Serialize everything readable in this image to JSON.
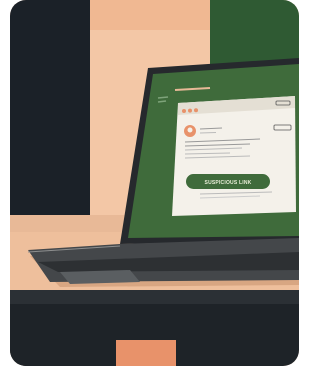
{
  "illustration": {
    "popup": {
      "button_label": "SUSPICIOUS LINK"
    }
  },
  "colors": {
    "dark_navy": "#1b2128",
    "peach": "#f3c7a6",
    "green": "#3f6b3b",
    "dark_green": "#2f5a33",
    "desk": "#e8b997",
    "laptop_body": "#26292d",
    "keyboard": "#3a3d40",
    "orange_accent": "#e8926a",
    "popup_white": "#f4f1ea"
  },
  "icons": [
    "laptop-icon",
    "browser-popup-icon",
    "avatar-icon",
    "link-button-icon"
  ]
}
